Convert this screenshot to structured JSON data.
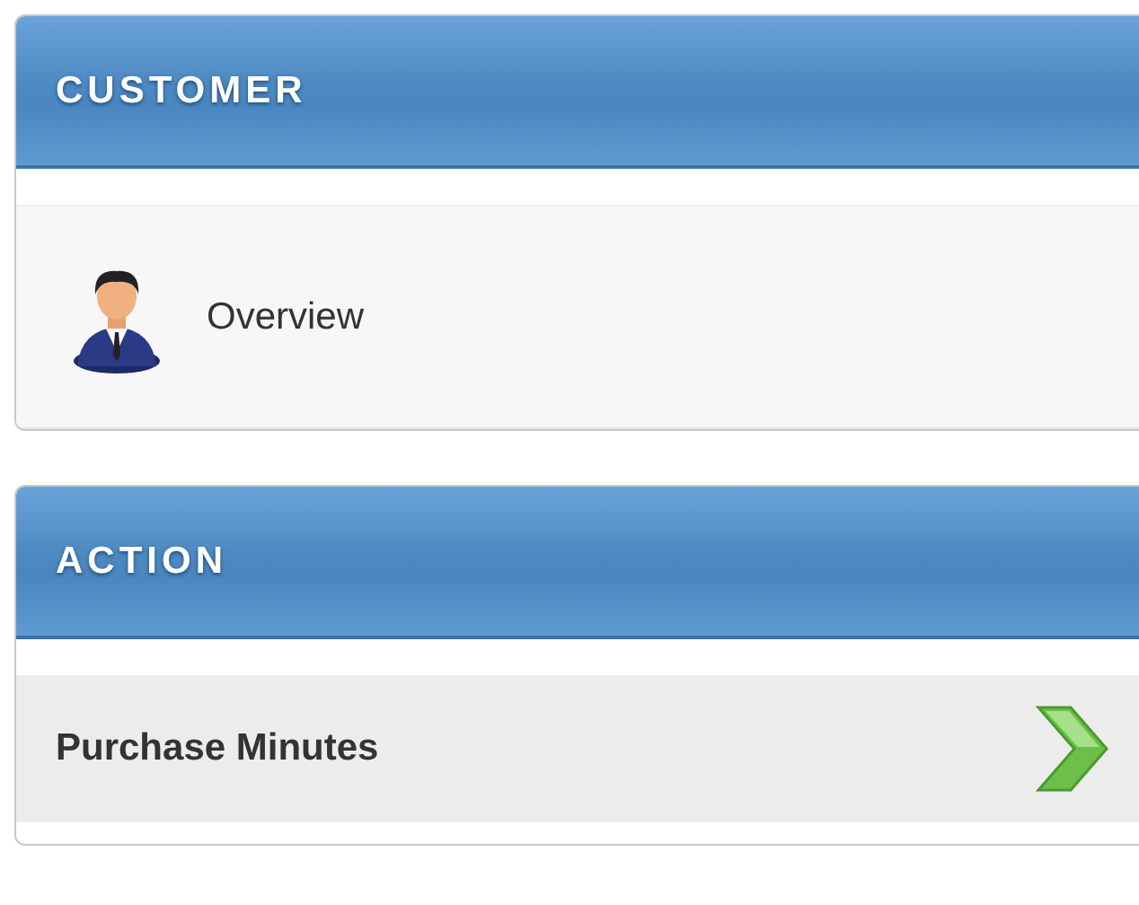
{
  "panels": [
    {
      "title": "CUSTOMER",
      "items": [
        {
          "kind": "profile",
          "label": "Overview"
        }
      ]
    },
    {
      "title": "ACTION",
      "items": [
        {
          "kind": "action",
          "label": "Purchase Minutes"
        }
      ]
    }
  ]
}
